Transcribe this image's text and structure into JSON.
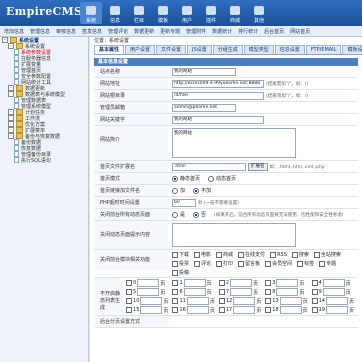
{
  "header": {
    "logo": "EmpireCMS",
    "nav": [
      {
        "label": "系统",
        "active": true
      },
      {
        "label": "信息"
      },
      {
        "label": "栏目"
      },
      {
        "label": "模板"
      },
      {
        "label": "用户"
      },
      {
        "label": "插件"
      },
      {
        "label": "商城"
      },
      {
        "label": "其他"
      }
    ]
  },
  "menubar": [
    "增加信息",
    "管理信息",
    "审核信息",
    "签发信息",
    "管理评论",
    "数据更新",
    "更新专题",
    "管理附件",
    "数据统计",
    "排行统计",
    "后台首页",
    "网站首页"
  ],
  "sidebar": {
    "items": [
      {
        "label": "系统设置",
        "level": 0,
        "type": "root"
      },
      {
        "label": "系统设置",
        "level": 1,
        "type": "folder"
      },
      {
        "label": "系统参数设置",
        "level": 2,
        "type": "doc",
        "selected": true
      },
      {
        "label": "在服务器信息",
        "level": 2,
        "type": "doc"
      },
      {
        "label": "扩展变量",
        "level": 2,
        "type": "doc"
      },
      {
        "label": "管理首页",
        "level": 2,
        "type": "doc"
      },
      {
        "label": "安全参数配置",
        "level": 2,
        "type": "doc"
      },
      {
        "label": "网站统计工具",
        "level": 2,
        "type": "doc"
      },
      {
        "label": "数据更新",
        "level": 1,
        "type": "folder"
      },
      {
        "label": "数据表与系统模型",
        "level": 1,
        "type": "folder"
      },
      {
        "label": "管理数据表",
        "level": 2,
        "type": "doc"
      },
      {
        "label": "管理系统模型",
        "level": 2,
        "type": "doc"
      },
      {
        "label": "计划任务",
        "level": 1,
        "type": "folder"
      },
      {
        "label": "工作流",
        "level": 1,
        "type": "folder"
      },
      {
        "label": "优化方案",
        "level": 1,
        "type": "folder"
      },
      {
        "label": "扩展菜单",
        "level": 1,
        "type": "folder"
      },
      {
        "label": "备份与恢复数据",
        "level": 1,
        "type": "folder"
      },
      {
        "label": "备份数据",
        "level": 2,
        "type": "doc"
      },
      {
        "label": "恢复数据",
        "level": 2,
        "type": "doc"
      },
      {
        "label": "管理备份目录",
        "level": 2,
        "type": "doc"
      },
      {
        "label": "执行SQL语句",
        "level": 2,
        "type": "doc"
      }
    ]
  },
  "main": {
    "breadcrumb": "位置：系统设置",
    "tabs": [
      "基本属性",
      "用户设置",
      "文件设置",
      "JS设置",
      "分组生成",
      "模型类型",
      "信息设置",
      "FTP/EMAIL",
      "模板设置"
    ],
    "section_title": "基本信息设置",
    "site_name_label": "站点名称",
    "site_name_value": "我的网站",
    "site_url_label": "网站地址",
    "site_url_value": "http://ecms009-4.99yueome.net:8888",
    "site_url_note": "(结尾需加\"/\"，如：/)",
    "root_label": "网站根目录",
    "root_value": "/d/file/",
    "root_note": "(结尾须加\"/\"，如：/)",
    "email_label": "管理员邮箱",
    "email_value": "admin@phome.net",
    "keywords_label": "网站关键字",
    "keywords_value": "我的网站",
    "desc_label": "网站简介",
    "desc_value": "我的网站",
    "index_ext_label": "首页文件扩展名",
    "index_ext_value": ".html",
    "index_ext_select": "扩展名",
    "index_ext_note": "如：.html,.htm,.xml,.php",
    "index_mode_label": "首页模式",
    "index_mode_options": [
      "静态首页",
      "动态首页"
    ],
    "index_mode_selected": 0,
    "index_path_label": "首页链接加文件名",
    "index_path_options": [
      "加",
      "不加"
    ],
    "index_path_selected": 1,
    "php_time_label": "PHP超时时间设置",
    "php_time_value": "60",
    "php_time_note": "秒 (一般不需要设置)",
    "close_label": "关闭前台所有动态页面",
    "close_options": [
      "是",
      "否"
    ],
    "close_note": "(如果开启，前台所有动态页面将无法使用，因性能和安全性考虑)",
    "close_msg_label": "关闭动态页面提示内容",
    "close_list_label": "关闭前台模块相关功能",
    "close_modules": [
      "下载",
      "电影",
      "商城",
      "在线支付",
      "RSS",
      "搜索",
      "全站搜索",
      "投票",
      "评论",
      "打印",
      "留言板",
      "会员空间",
      "标签",
      "专题",
      "投稿"
    ],
    "page_label": "不开启静态列表生成",
    "page_grid": [
      {
        "value": "0"
      },
      {
        "value": "1"
      },
      {
        "value": "2"
      },
      {
        "value": "3"
      },
      {
        "value": "4"
      },
      {
        "value": "5"
      },
      {
        "value": "6"
      },
      {
        "value": "7"
      },
      {
        "value": "8"
      },
      {
        "value": "9"
      },
      {
        "value": "10"
      },
      {
        "value": "11"
      },
      {
        "value": "12"
      },
      {
        "value": "13"
      },
      {
        "value": "14"
      },
      {
        "value": "15"
      },
      {
        "value": "16"
      },
      {
        "value": "17"
      },
      {
        "value": "18"
      },
      {
        "value": "19"
      }
    ],
    "grid_suffix": "页",
    "bottom_label": "后台分页设置方式"
  }
}
